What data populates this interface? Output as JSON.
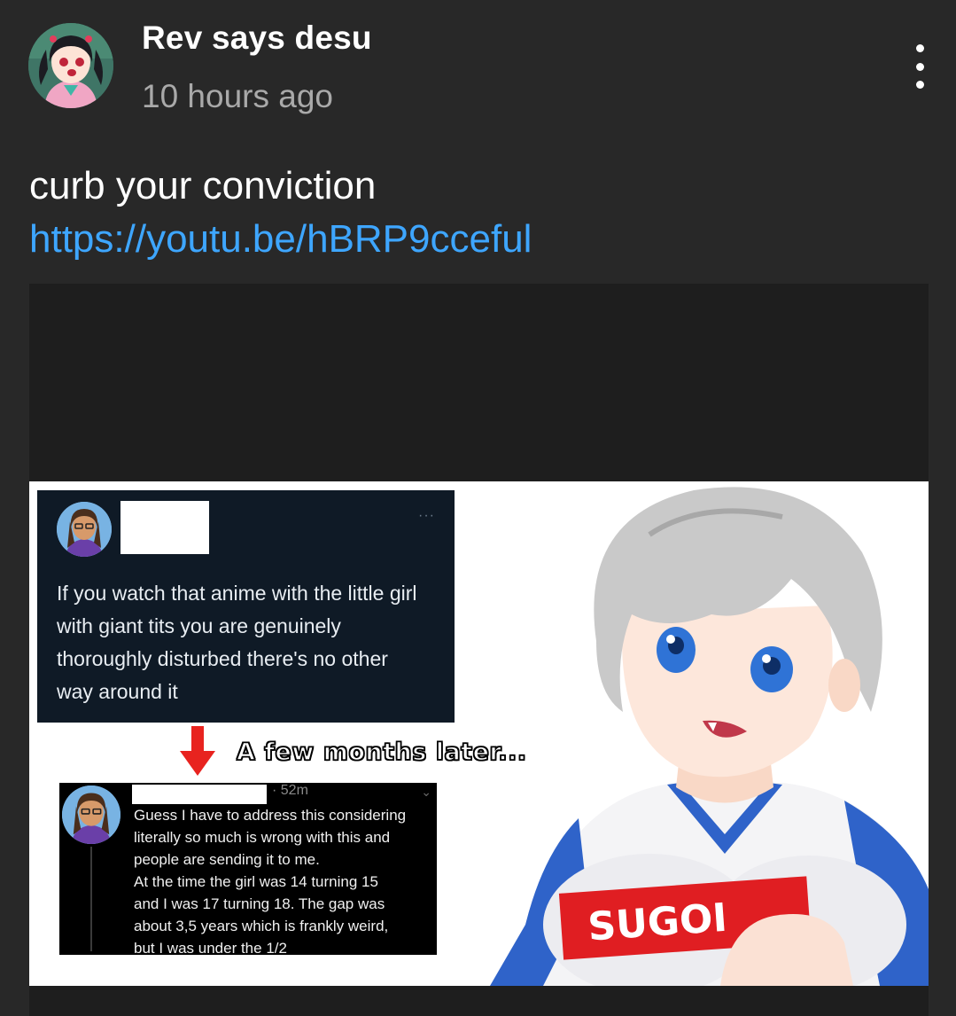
{
  "post": {
    "author": "Rev says desu",
    "time": "10 hours ago",
    "text": "curb your conviction",
    "link": "https://youtu.be/hBRP9cceful"
  },
  "meme": {
    "tweet1": {
      "text": "If you watch that anime with the little girl with giant tits you are genuinely thoroughly disturbed there's no other way around it",
      "more": "···"
    },
    "caption": "A few months later...",
    "tweet2": {
      "time": "· 52m",
      "chevron": "⌄",
      "lines": [
        "Guess I have to address this considering",
        "literally so much is wrong with this and",
        "people are sending it to me.",
        "At the time the girl was 14 turning 15",
        "and I was 17 turning 18. The gap was",
        "about 3,5 years which is frankly weird,",
        "but I was under the 1/2"
      ]
    },
    "shirt_text": "SUGOI"
  },
  "colors": {
    "background": "#282828",
    "link": "#3ea6ff",
    "secondary_text": "#a9a9a9",
    "arrow": "#e8231f",
    "shirt_blue": "#2f63c9"
  },
  "icons": {
    "menu": "more-vert-icon",
    "arrow": "down-arrow-icon"
  }
}
